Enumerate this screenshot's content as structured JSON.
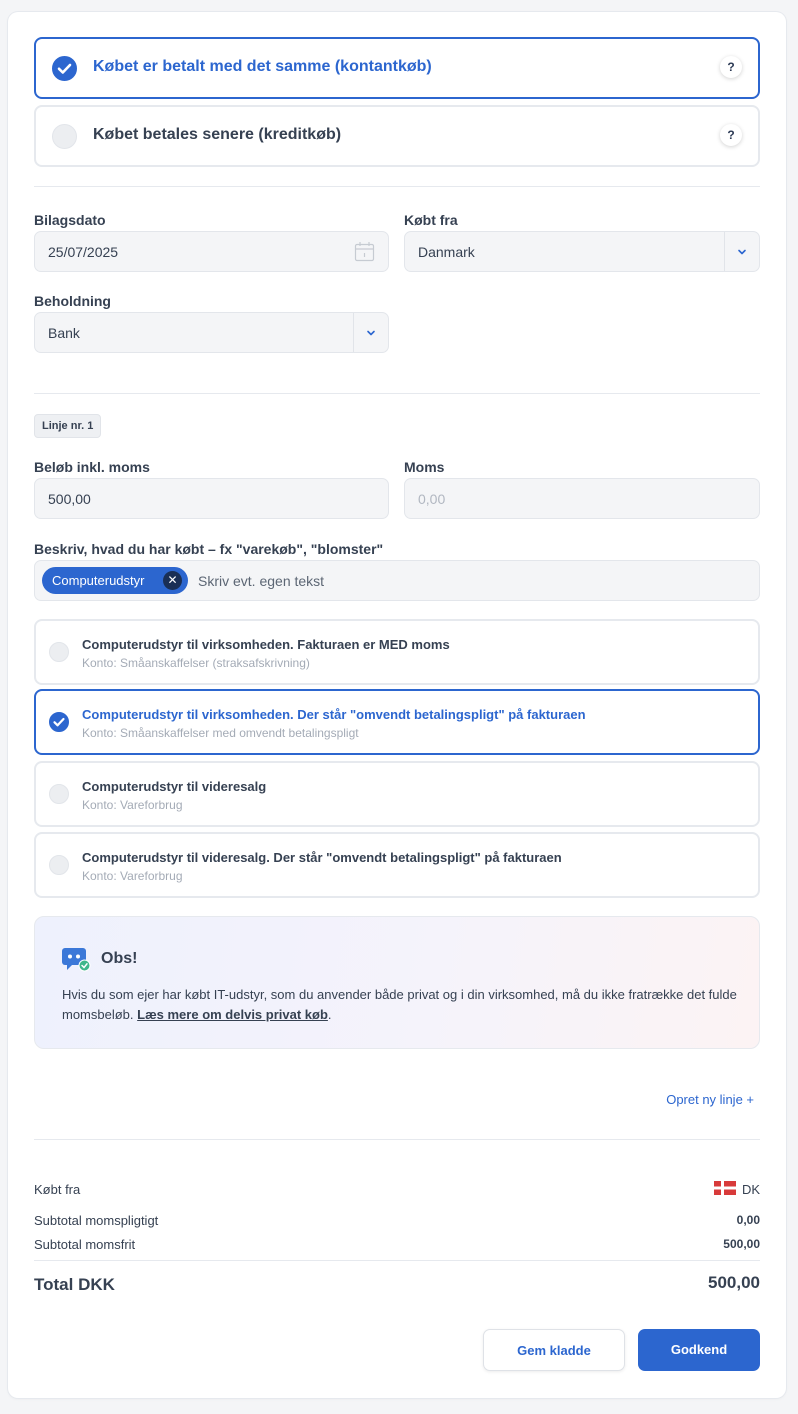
{
  "payment_options": [
    {
      "label": "Købet er betalt med det samme (kontantkøb)",
      "selected": true,
      "help": "?"
    },
    {
      "label": "Købet betales senere (kreditkøb)",
      "selected": false,
      "help": "?"
    }
  ],
  "fields": {
    "bilagsdato": {
      "label": "Bilagsdato",
      "value": "25/07/2025"
    },
    "kobt_fra": {
      "label": "Købt fra",
      "value": "Danmark"
    },
    "beholdning": {
      "label": "Beholdning",
      "value": "Bank"
    }
  },
  "line": {
    "badge": "Linje nr. 1",
    "amount": {
      "label": "Beløb inkl. moms",
      "value": "500,00"
    },
    "vat": {
      "label": "Moms",
      "placeholder": "0,00"
    },
    "description": {
      "label": "Beskriv, hvad du har købt – fx \"varekøb\", \"blomster\"",
      "tag": "Computerudstyr",
      "placeholder": "Skriv evt. egen tekst"
    },
    "accounts": [
      {
        "title": "Computerudstyr til virksomheden. Fakturaen er MED moms",
        "subtitle": "Konto: Småanskaffelser (straksafskrivning)",
        "selected": false
      },
      {
        "title": "Computerudstyr til virksomheden. Der står \"omvendt betalingspligt\" på fakturaen",
        "subtitle": "Konto: Småanskaffelser med omvendt betalingspligt",
        "selected": true
      },
      {
        "title": "Computerudstyr til videresalg",
        "subtitle": "Konto: Vareforbrug",
        "selected": false
      },
      {
        "title": "Computerudstyr til videresalg. Der står \"omvendt betalingspligt\" på fakturaen",
        "subtitle": "Konto: Vareforbrug",
        "selected": false
      }
    ]
  },
  "notice": {
    "title": "Obs!",
    "body": "Hvis du som ejer har købt IT-udstyr, som du anvender både privat og i din virksomhed, må du ikke fratrække det fulde momsbeløb.",
    "link": "Læs mere om delvis privat køb",
    "end": "."
  },
  "new_line_link": "Opret ny linje +",
  "summary": {
    "kobt_fra_label": "Købt fra",
    "kobt_fra_value": "DK",
    "subtotal_momspligtigt_label": "Subtotal momspligtigt",
    "subtotal_momspligtigt_value": "0,00",
    "subtotal_momsfrit_label": "Subtotal momsfrit",
    "subtotal_momsfrit_value": "500,00",
    "total_label": "Total DKK",
    "total_value": "500,00"
  },
  "buttons": {
    "save_draft": "Gem kladde",
    "approve": "Godkend"
  },
  "colors": {
    "accent": "#2c66cf",
    "text": "#364152",
    "muted": "#a4abb6",
    "flag_red": "#d83a3a"
  }
}
